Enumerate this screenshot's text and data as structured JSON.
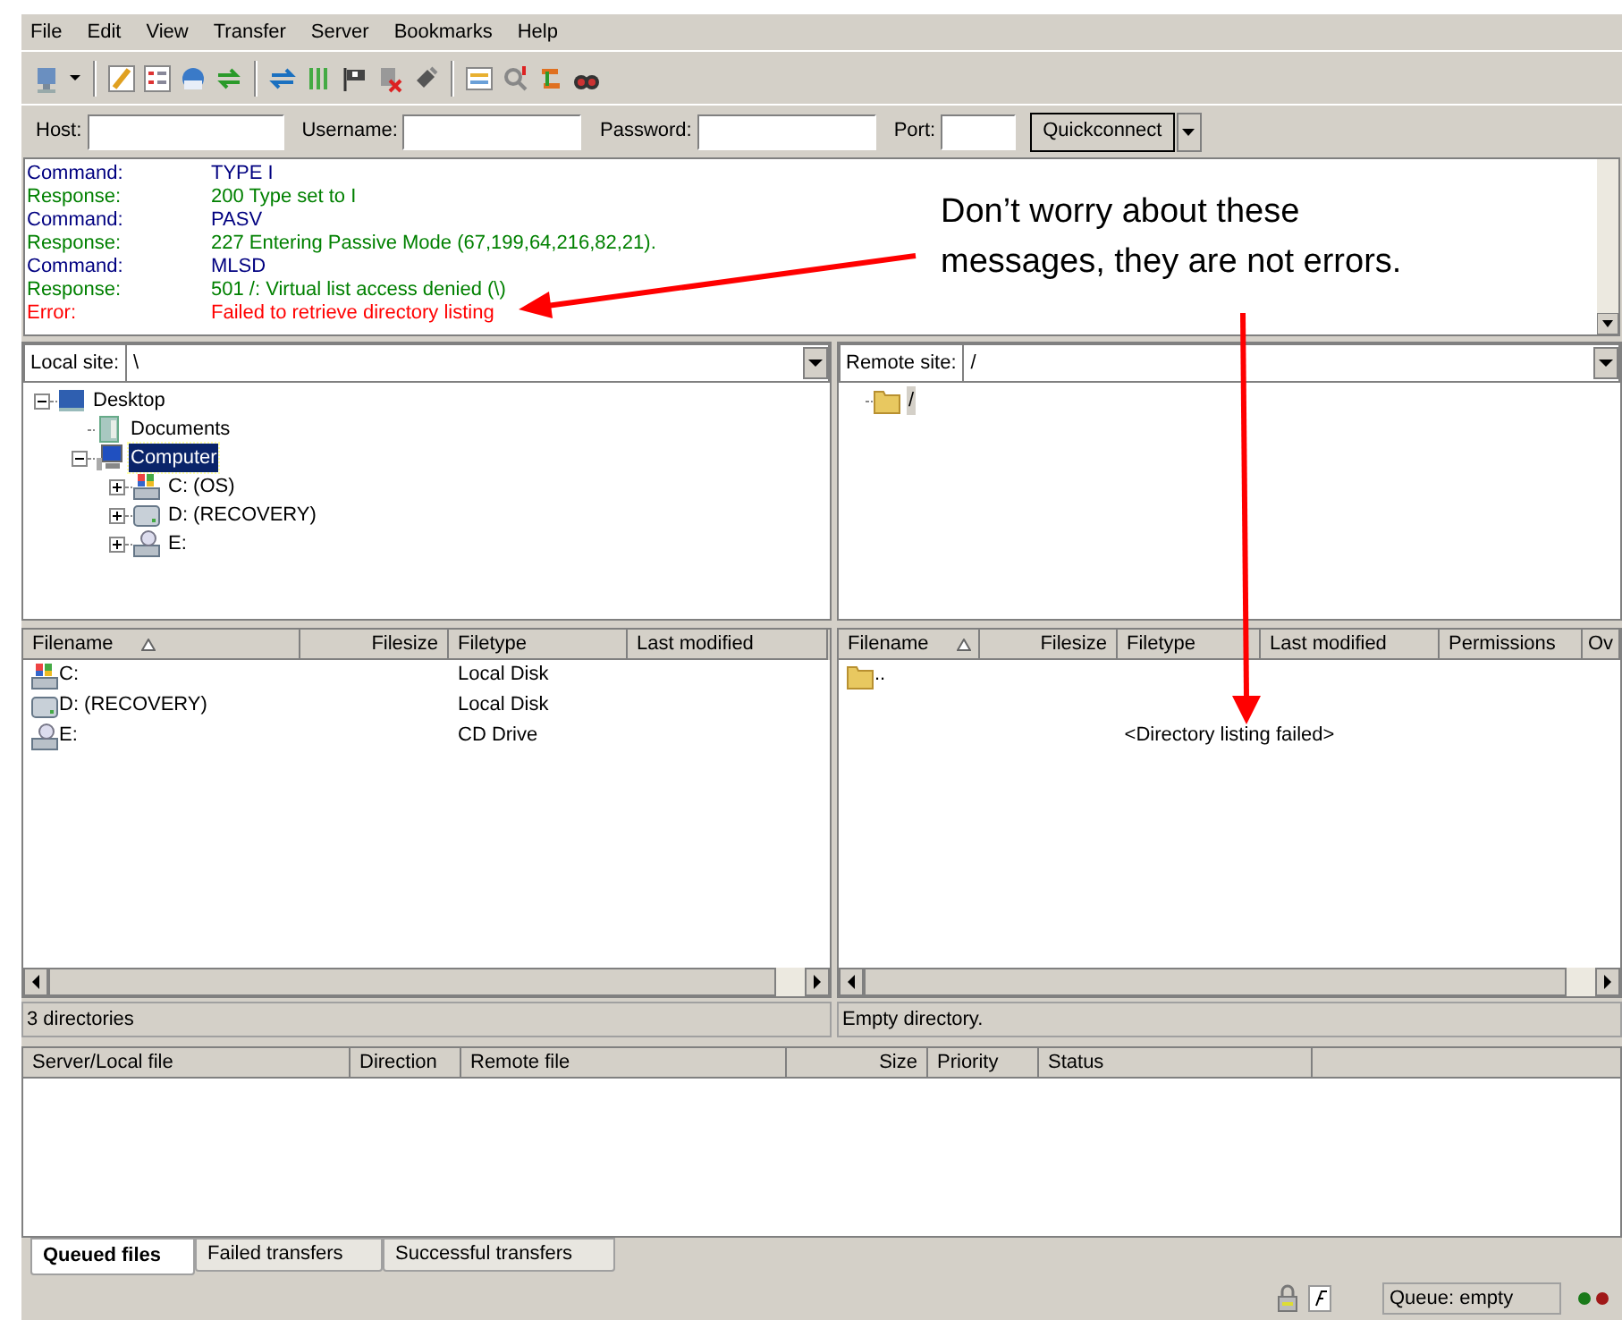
{
  "menu": [
    {
      "label": "File"
    },
    {
      "label": "Edit"
    },
    {
      "label": "View"
    },
    {
      "label": "Transfer"
    },
    {
      "label": "Server"
    },
    {
      "label": "Bookmarks"
    },
    {
      "label": "Help"
    }
  ],
  "quickconnect": {
    "fields": [
      {
        "label": "Host:"
      },
      {
        "label": "Username:"
      },
      {
        "label": "Password:"
      },
      {
        "label": "Port:"
      }
    ],
    "button": "Quickconnect"
  },
  "message_log": [
    {
      "kind": "command",
      "label": "Command:",
      "text": "TYPE I"
    },
    {
      "kind": "response",
      "label": "Response:",
      "text": "200 Type set to I"
    },
    {
      "kind": "command",
      "label": "Command:",
      "text": "PASV"
    },
    {
      "kind": "response",
      "label": "Response:",
      "text": "227 Entering Passive Mode (67,199,64,216,82,21)."
    },
    {
      "kind": "command",
      "label": "Command:",
      "text": "MLSD"
    },
    {
      "kind": "response",
      "label": "Response:",
      "text": "501 /: Virtual list access denied (\\)"
    },
    {
      "kind": "error",
      "label": "Error:",
      "text": "Failed to retrieve directory listing"
    }
  ],
  "annotation": {
    "lines": [
      "Don’t worry about these",
      "messages, they are not errors."
    ]
  },
  "local": {
    "site_label": "Local site:",
    "path": "\\",
    "tree_focused": true,
    "tree": [
      {
        "label": "Desktop",
        "kind": "desktop",
        "expanded": true,
        "selected": false,
        "children": [
          {
            "label": "Documents",
            "kind": "documents",
            "selected": false
          },
          {
            "label": "Computer",
            "kind": "computer",
            "expanded": true,
            "selected": true,
            "children": [
              {
                "label": "C: (OS)",
                "kind": "system_drive",
                "expanded": false,
                "selected": false
              },
              {
                "label": "D: (RECOVERY)",
                "kind": "drive",
                "expanded": false,
                "selected": false
              },
              {
                "label": "E:",
                "kind": "cd_drive",
                "expanded": false,
                "selected": false
              }
            ]
          }
        ]
      }
    ],
    "columns": [
      {
        "label": "Filename",
        "sorted": true
      },
      {
        "label": "Filesize",
        "sorted": false
      },
      {
        "label": "Filetype",
        "sorted": false
      },
      {
        "label": "Last modified",
        "sorted": false
      }
    ],
    "rows": [
      {
        "kind": "system_drive",
        "name": "C:",
        "filetype": "Local Disk"
      },
      {
        "kind": "drive",
        "name": "D: (RECOVERY)",
        "filetype": "Local Disk"
      },
      {
        "kind": "cd_drive",
        "name": "E:",
        "filetype": "CD Drive"
      }
    ],
    "status": "3 directories"
  },
  "remote": {
    "site_label": "Remote site:",
    "path": "/",
    "tree_focused": false,
    "tree": [
      {
        "label": "/",
        "kind": "folder",
        "selected": true
      }
    ],
    "columns": [
      {
        "label": "Filename",
        "sorted": true
      },
      {
        "label": "Filesize",
        "sorted": false
      },
      {
        "label": "Filetype",
        "sorted": false
      },
      {
        "label": "Last modified",
        "sorted": false
      },
      {
        "label": "Permissions",
        "sorted": false
      },
      {
        "label": "Ov",
        "sorted": false
      }
    ],
    "rows": [
      {
        "kind": "folder",
        "name": ".."
      }
    ],
    "message": "<Directory listing failed>",
    "status": "Empty directory."
  },
  "queue": {
    "columns": [
      {
        "label": "Server/Local file"
      },
      {
        "label": "Direction"
      },
      {
        "label": "Remote file"
      },
      {
        "label": "Size"
      },
      {
        "label": "Priority"
      },
      {
        "label": "Status"
      }
    ]
  },
  "tabs": [
    {
      "label": "Queued files",
      "selected": true
    },
    {
      "label": "Failed transfers",
      "selected": false
    },
    {
      "label": "Successful transfers",
      "selected": false
    }
  ],
  "status_bar": {
    "queue": "Queue: empty"
  }
}
